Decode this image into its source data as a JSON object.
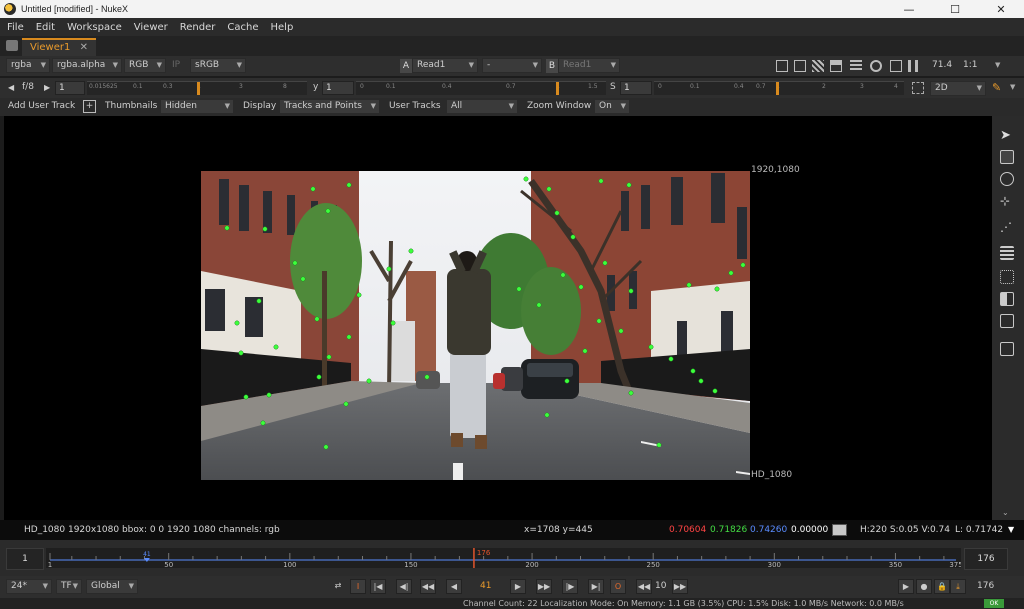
{
  "window": {
    "title": "Untitled [modified] - NukeX"
  },
  "menu": [
    "File",
    "Edit",
    "Workspace",
    "Viewer",
    "Render",
    "Cache",
    "Help"
  ],
  "tab": {
    "label": "Viewer1",
    "close": "✕"
  },
  "toolbar1": {
    "channels": "rgba",
    "alpha": "rgba.alpha",
    "display": "RGB",
    "ip": "IP",
    "lut": "sRGB",
    "a_label": "A",
    "a_input": "Read1",
    "op": "-",
    "b_label": "B",
    "b_input": "Read1",
    "zoom_pct": "71.4",
    "zoom_ratio": "1:1"
  },
  "toolbar2": {
    "fstop": "f/8",
    "gain": "1",
    "gain_ticks": [
      "0.015625",
      "0.1",
      "0.3",
      "1",
      "3",
      "8"
    ],
    "y_label": "y",
    "gamma": "1",
    "gamma_ticks": [
      "0",
      "0.1",
      "0.4",
      "0.7",
      "1",
      "1.5"
    ],
    "s_label": "S",
    "sat": "1",
    "sat_ticks": [
      "0",
      "0.1",
      "0.4",
      "0.7",
      "1",
      "2",
      "3",
      "4"
    ],
    "view_mode": "2D"
  },
  "toolbar3": {
    "add_track": "Add User Track",
    "thumbnails_label": "Thumbnails",
    "thumbnails": "Hidden",
    "display_label": "Display",
    "display": "Tracks and Points",
    "user_tracks_label": "User Tracks",
    "user_tracks": "All",
    "zoom_window_label": "Zoom Window",
    "zoom_window": "On"
  },
  "viewer": {
    "format_top": "1920,1080",
    "format_bottom": "HD_1080"
  },
  "info": {
    "format": "HD_1080 1920x1080  bbox: 0 0 1920 1080 channels: rgb",
    "coords": "x=1708 y=445",
    "r": "0.70604",
    "g": "0.71826",
    "b": "0.74260",
    "a": "0.00000",
    "hsv": "H:220 S:0.05 V:0.74",
    "luma": "L: 0.71742",
    "colors": {
      "r": "#ff4444",
      "g": "#44dd44",
      "b": "#5a8cff"
    }
  },
  "timeline": {
    "in": "1",
    "out": "176",
    "current": "176",
    "ticks": [
      "1",
      "50",
      "100",
      "150",
      "200",
      "250",
      "300",
      "350",
      "375"
    ],
    "marker_in": "41",
    "range_end": 375
  },
  "playback": {
    "fps": "24*",
    "tf": "TF",
    "scope": "Global",
    "frame": "41",
    "step": "10",
    "end": "176"
  },
  "status": {
    "text": "Channel Count: 22  Localization Mode: On  Memory: 1.1 GB (3.5%)  CPU: 1.5%  Disk: 1.0 MB/s  Network: 0.0 MB/s",
    "ok": "OK"
  }
}
